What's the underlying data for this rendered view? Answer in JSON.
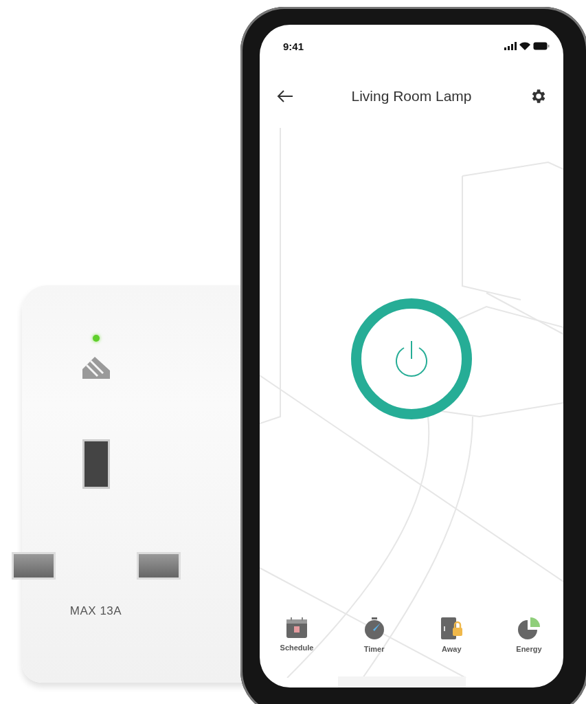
{
  "plug": {
    "label": "MAX 13A",
    "led_on": true
  },
  "status_bar": {
    "time": "9:41"
  },
  "header": {
    "title": "Living Room Lamp"
  },
  "power": {
    "on": true
  },
  "features": [
    {
      "kind": "schedule",
      "label": "Schedule"
    },
    {
      "kind": "timer",
      "label": "Timer"
    },
    {
      "kind": "away",
      "label": "Away"
    },
    {
      "kind": "energy",
      "label": "Energy"
    }
  ]
}
